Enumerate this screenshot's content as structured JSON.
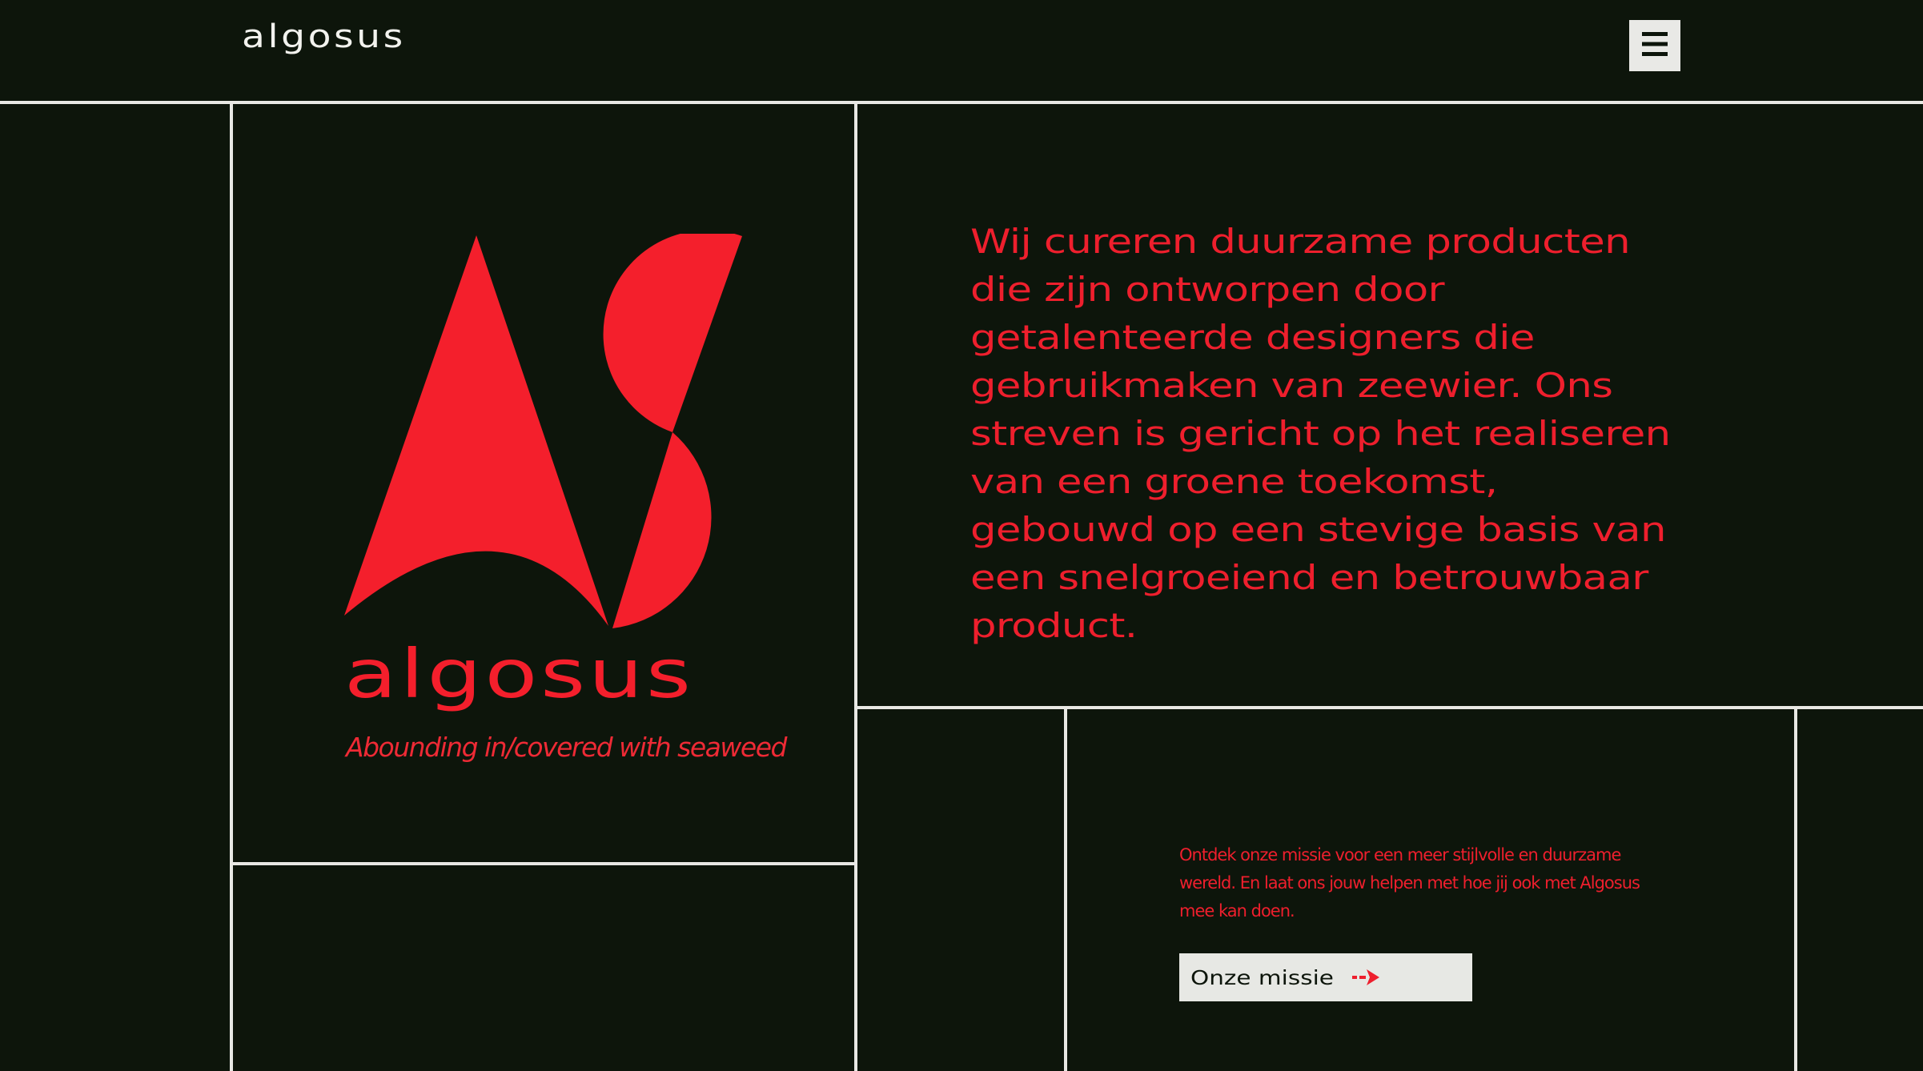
{
  "header": {
    "brand": "algosus",
    "menu_icon": "hamburger-menu-icon"
  },
  "logo": {
    "mark_icon": "algosus-as-monogram-icon",
    "wordmark": "algosus",
    "tagline": "Abounding in/covered with seaweed"
  },
  "hero": {
    "text": "Wij cureren duurzame producten die zijn ontworpen door getalenteerde designers die gebruikmaken van zeewier. Ons streven is gericht op het realiseren van een groene toekomst, gebouwd op een stevige basis van een snelgroeiend en betrouwbaar product."
  },
  "mission": {
    "text": "Ontdek onze missie voor een meer stijlvolle en duurzame wereld.  En laat ons jouw helpen met hoe jij ook met Algosus mee kan doen.",
    "button_label": "Onze missie",
    "button_icon": "arrow-right-icon"
  },
  "colors": {
    "background": "#0d150b",
    "accent": "#f41f2c",
    "grid_lines": "#e8e8e4",
    "button_bg": "#e7e8e4"
  }
}
